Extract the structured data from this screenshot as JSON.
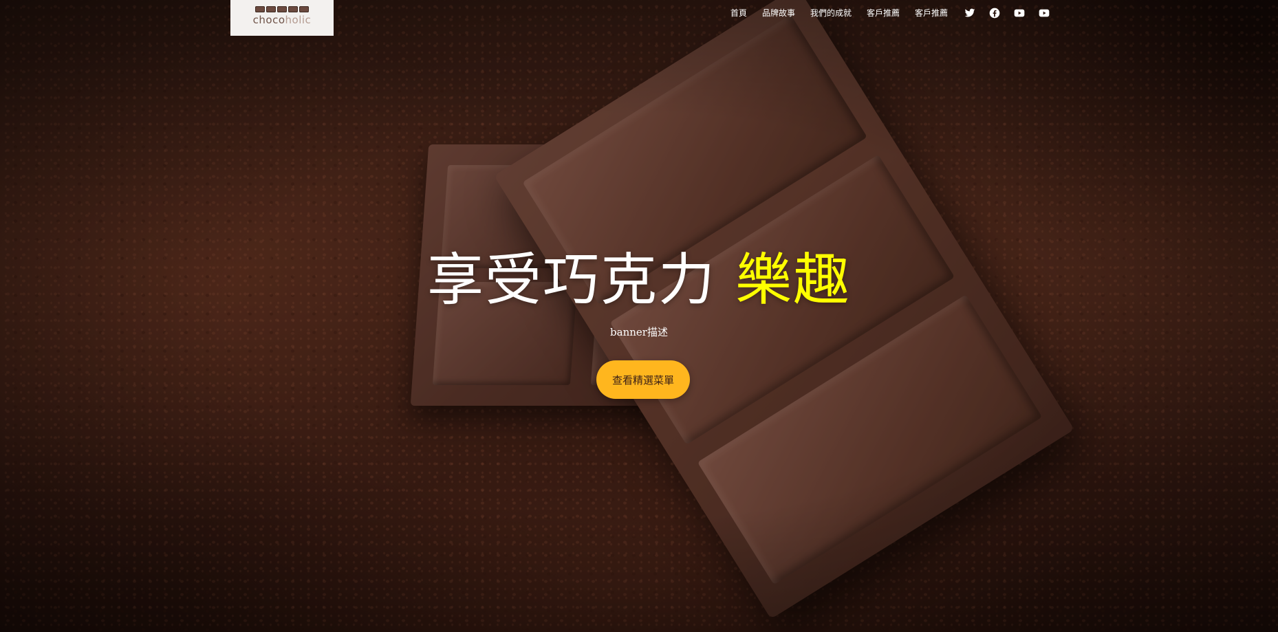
{
  "brand": {
    "logo_text_a": "choco",
    "logo_text_b": "holic"
  },
  "nav": {
    "items": [
      {
        "label": "首頁"
      },
      {
        "label": "品牌故事"
      },
      {
        "label": "我們的成就"
      },
      {
        "label": "客戶推薦"
      },
      {
        "label": "客戶推薦"
      }
    ],
    "social": [
      "twitter-icon",
      "facebook-icon",
      "youtube-icon",
      "youtube-icon"
    ]
  },
  "hero": {
    "headline_main": "享受巧克力 ",
    "headline_highlight": "樂趣",
    "description": "banner描述",
    "cta_label": "查看精選菜單"
  },
  "colors": {
    "highlight": "#ffff00",
    "cta_background": "#ffb61e",
    "nav_text": "#ffffff",
    "logo_background": "#f3f1ef"
  }
}
